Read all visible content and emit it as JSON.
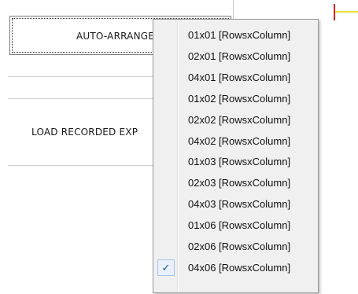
{
  "buttons": {
    "auto_arrange": "AUTO-ARRANGE",
    "load_recorded": "LOAD RECORDED EXP"
  },
  "menu": {
    "checked_index": 11,
    "check_glyph": "✓",
    "items": [
      {
        "label": "01x01 [RowsxColumn]"
      },
      {
        "label": "02x01 [RowsxColumn]"
      },
      {
        "label": "04x01 [RowsxColumn]"
      },
      {
        "label": "01x02 [RowsxColumn]"
      },
      {
        "label": "02x02 [RowsxColumn]"
      },
      {
        "label": "04x02 [RowsxColumn]"
      },
      {
        "label": "01x03 [RowsxColumn]"
      },
      {
        "label": "02x03 [RowsxColumn]"
      },
      {
        "label": "04x03 [RowsxColumn]"
      },
      {
        "label": "01x06 [RowsxColumn]"
      },
      {
        "label": "02x06 [RowsxColumn]"
      },
      {
        "label": "04x06 [RowsxColumn]"
      }
    ]
  },
  "colors": {
    "menu_bg": "#f0f0f0",
    "check_bg": "#e8f0fb",
    "check_border": "#a8c4ea",
    "marker_red": "#e02020",
    "marker_yellow": "#f3e03a"
  },
  "icons": {
    "check": "check-icon"
  }
}
